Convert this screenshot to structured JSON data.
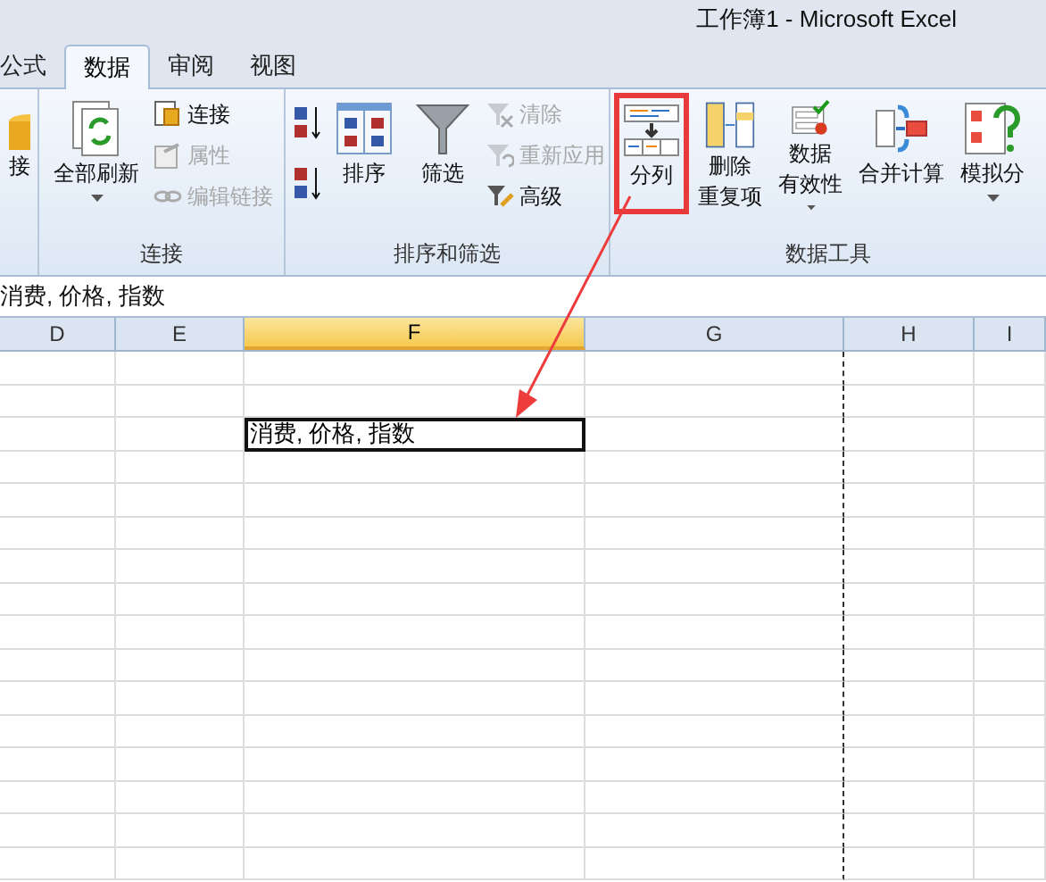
{
  "window": {
    "title": "工作簿1 - Microsoft Excel"
  },
  "tabs": [
    {
      "label": "公式",
      "selected": false
    },
    {
      "label": "数据",
      "selected": true
    },
    {
      "label": "审阅",
      "selected": false
    },
    {
      "label": "视图",
      "selected": false
    }
  ],
  "ribbon": [
    {
      "items": [
        {
          "kind": "large",
          "lines": [
            "接"
          ],
          "disabled": false,
          "dropdown": false,
          "highlighted": false
        }
      ]
    },
    {
      "label": "连接",
      "items": [
        {
          "kind": "large",
          "lines": [
            "全部刷新"
          ],
          "disabled": false,
          "dropdown": true,
          "highlighted": false
        },
        {
          "kind": "stack",
          "buttons": [
            {
              "label": "连接",
              "disabled": false
            },
            {
              "label": "属性",
              "disabled": true
            },
            {
              "label": "编辑链接",
              "disabled": true
            }
          ]
        }
      ]
    },
    {
      "label": "排序和筛选",
      "items": [
        {
          "kind": "sortpair"
        },
        {
          "kind": "large",
          "lines": [
            "排序"
          ],
          "disabled": false,
          "dropdown": false,
          "highlighted": false
        },
        {
          "kind": "large",
          "lines": [
            "筛选"
          ],
          "disabled": false,
          "dropdown": false,
          "highlighted": false
        },
        {
          "kind": "stack",
          "buttons": [
            {
              "label": "清除",
              "disabled": true
            },
            {
              "label": "重新应用",
              "disabled": true
            },
            {
              "label": "高级",
              "disabled": false
            }
          ]
        }
      ]
    },
    {
      "label": "数据工具",
      "items": [
        {
          "kind": "large",
          "lines": [
            "分列"
          ],
          "disabled": false,
          "dropdown": false,
          "highlighted": true
        },
        {
          "kind": "large",
          "lines": [
            "删除",
            "重复项"
          ],
          "disabled": false,
          "dropdown": false,
          "highlighted": false
        },
        {
          "kind": "large",
          "lines": [
            "数据",
            "有效性"
          ],
          "disabled": false,
          "dropdown": true,
          "highlighted": false
        },
        {
          "kind": "large",
          "lines": [
            "合并计算"
          ],
          "disabled": false,
          "dropdown": false,
          "highlighted": false
        },
        {
          "kind": "large",
          "lines": [
            "模拟分"
          ],
          "disabled": false,
          "dropdown": true,
          "highlighted": false
        }
      ]
    }
  ],
  "formula_bar": {
    "value": "消费, 价格, 指数"
  },
  "columns": [
    {
      "label": "D",
      "selected": false
    },
    {
      "label": "E",
      "selected": false
    },
    {
      "label": "F",
      "selected": true
    },
    {
      "label": "G",
      "selected": false
    },
    {
      "label": "H",
      "selected": false
    },
    {
      "label": "I",
      "selected": false
    }
  ],
  "active_cell": {
    "value": "消费, 价格, 指数"
  },
  "annotation": {
    "kind": "arrow"
  }
}
